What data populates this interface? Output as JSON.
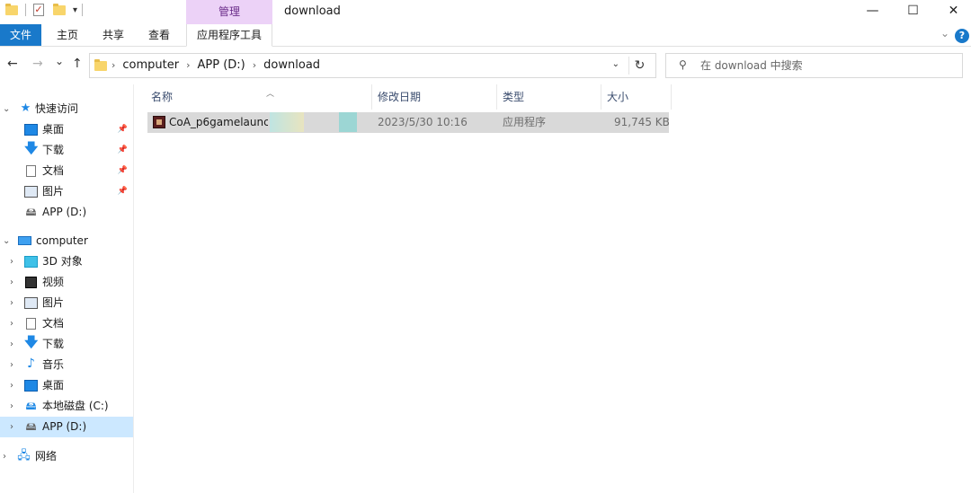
{
  "window": {
    "title": "download",
    "contextual_tab": "管理",
    "controls": {
      "minimize": "—",
      "maximize": "☐",
      "close": "✕"
    }
  },
  "quick_access_toolbar": {
    "dropdown": "▾"
  },
  "ribbon": {
    "tabs": [
      {
        "label": "文件",
        "active": true
      },
      {
        "label": "主页"
      },
      {
        "label": "共享"
      },
      {
        "label": "查看"
      },
      {
        "label": "应用程序工具"
      }
    ],
    "expand_icon": "chevron-down-icon",
    "help_label": "?"
  },
  "navigation": {
    "back": "←",
    "forward": "→",
    "recent": "⌄",
    "up": "↑",
    "breadcrumb": [
      "computer",
      "APP (D:)",
      "download"
    ],
    "refresh": "↻",
    "search": {
      "placeholder": "在 download 中搜索"
    }
  },
  "nav_pane": {
    "quick_access": {
      "label": "快速访问"
    },
    "quick_items": [
      {
        "label": "桌面",
        "icon": "desktop-icon",
        "pinned": true
      },
      {
        "label": "下载",
        "icon": "download-icon",
        "pinned": true
      },
      {
        "label": "文档",
        "icon": "document-icon",
        "pinned": true
      },
      {
        "label": "图片",
        "icon": "pictures-icon",
        "pinned": true
      },
      {
        "label": "APP (D:)",
        "icon": "drive-icon",
        "pinned": false
      }
    ],
    "computer": {
      "label": "computer"
    },
    "computer_items": [
      {
        "label": "3D 对象",
        "icon": "3d-objects-icon"
      },
      {
        "label": "视频",
        "icon": "video-icon"
      },
      {
        "label": "图片",
        "icon": "pictures-icon"
      },
      {
        "label": "文档",
        "icon": "document-icon"
      },
      {
        "label": "下载",
        "icon": "download-icon"
      },
      {
        "label": "音乐",
        "icon": "music-icon"
      },
      {
        "label": "桌面",
        "icon": "desktop-icon"
      },
      {
        "label": "本地磁盘 (C:)",
        "icon": "system-drive-icon"
      },
      {
        "label": "APP (D:)",
        "icon": "drive-icon",
        "selected": true
      }
    ],
    "network": {
      "label": "网络"
    }
  },
  "file_list": {
    "columns": [
      "名称",
      "修改日期",
      "类型",
      "大小"
    ],
    "rows": [
      {
        "name": "CoA_p6gamelaunche",
        "modified": "2023/5/30 10:16",
        "type": "应用程序",
        "size": "91,745 KB",
        "selected": true
      }
    ]
  },
  "colors": {
    "accent": "#1979ca",
    "manage_tab": "#ecd2f7",
    "selection": "#cce8ff",
    "row_selected": "#d9d9d9"
  }
}
